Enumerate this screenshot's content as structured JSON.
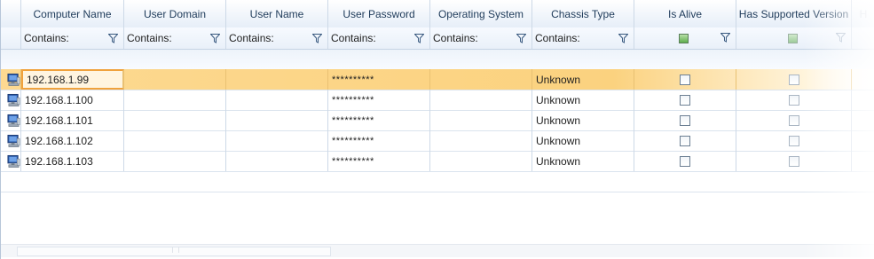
{
  "columns": [
    {
      "label": "Computer Name"
    },
    {
      "label": "User Domain"
    },
    {
      "label": "User Name"
    },
    {
      "label": "User Password"
    },
    {
      "label": "Operating System"
    },
    {
      "label": "Chassis Type"
    },
    {
      "label": "Is Alive"
    },
    {
      "label": "Has Supported Version"
    },
    {
      "label": "H"
    }
  ],
  "filter": {
    "contains_label": "Contains:"
  },
  "rows": [
    {
      "computer_name": "192.168.1.99",
      "user_domain": "",
      "user_name": "",
      "password": "**********",
      "os": "",
      "chassis": "Unknown",
      "is_alive": false,
      "has_supported_version": false,
      "selected": true
    },
    {
      "computer_name": "192.168.1.100",
      "user_domain": "",
      "user_name": "",
      "password": "**********",
      "os": "",
      "chassis": "Unknown",
      "is_alive": false,
      "has_supported_version": false,
      "selected": false
    },
    {
      "computer_name": "192.168.1.101",
      "user_domain": "",
      "user_name": "",
      "password": "**********",
      "os": "",
      "chassis": "Unknown",
      "is_alive": false,
      "has_supported_version": false,
      "selected": false
    },
    {
      "computer_name": "192.168.1.102",
      "user_domain": "",
      "user_name": "",
      "password": "**********",
      "os": "",
      "chassis": "Unknown",
      "is_alive": false,
      "has_supported_version": false,
      "selected": false
    },
    {
      "computer_name": "192.168.1.103",
      "user_domain": "",
      "user_name": "",
      "password": "**********",
      "os": "",
      "chassis": "Unknown",
      "is_alive": false,
      "has_supported_version": false,
      "selected": false
    }
  ],
  "icons": {
    "row": "computer-icon",
    "filter": "funnel-icon"
  },
  "colors": {
    "selection": "#fbd27f",
    "selection_border": "#f0a23c",
    "header_text": "#1f3b5a"
  }
}
